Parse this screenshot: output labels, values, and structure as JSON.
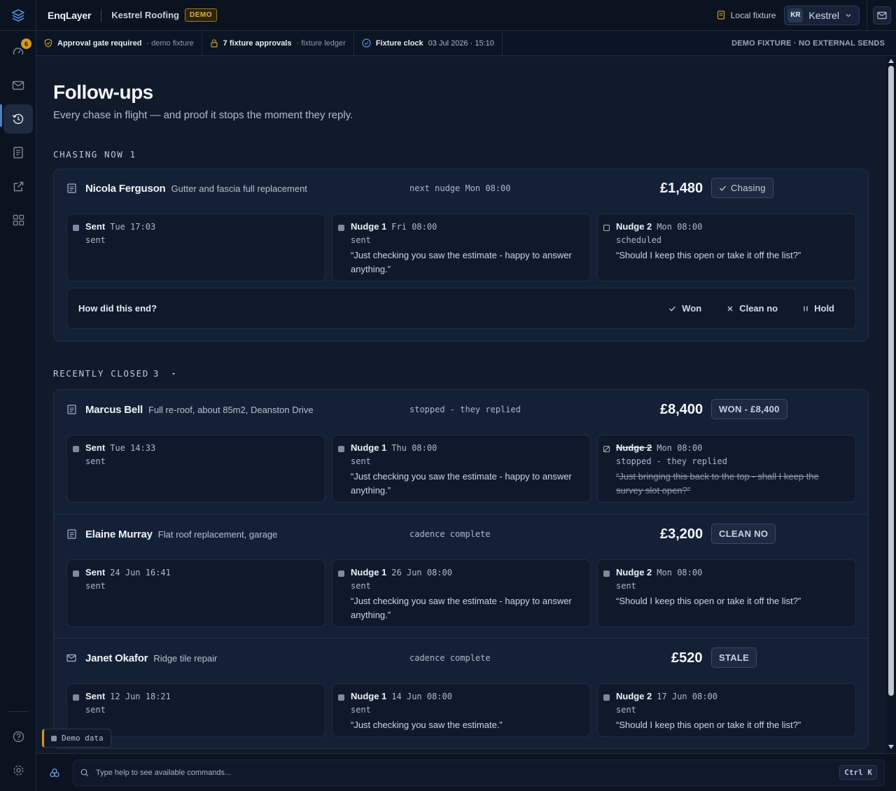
{
  "app": {
    "brand": "EnqLayer",
    "tenant": "Kestrel Roofing",
    "demo_badge": "DEMO",
    "local_fixture": "Local fixture",
    "user_initials": "KR",
    "user_name": "Kestrel"
  },
  "sidebar": {
    "badge_count": "6",
    "items": [
      {
        "icon": "gauge-icon"
      },
      {
        "icon": "mail-icon"
      },
      {
        "icon": "history-icon"
      },
      {
        "icon": "document-icon"
      },
      {
        "icon": "external-link-icon"
      },
      {
        "icon": "grid-icon"
      },
      {
        "icon": "help-icon"
      },
      {
        "icon": "settings-icon"
      }
    ]
  },
  "status": {
    "approval_gate": "Approval gate required",
    "approval_gate_sub": "· demo fixture",
    "approvals": "7 fixture approvals",
    "approvals_sub": "· fixture ledger",
    "clock_label": "Fixture clock",
    "clock_value": "03 Jul 2026 · 15:10",
    "right_notice": "DEMO FIXTURE · NO EXTERNAL SENDS"
  },
  "page": {
    "title": "Follow-ups",
    "subtitle": "Every chase in flight — and proof it stops the moment they reply."
  },
  "chasing": {
    "label": "CHASING NOW",
    "count": "1",
    "item": {
      "name": "Nicola Ferguson",
      "job": "Gutter and fascia full replacement",
      "status": "next nudge Mon 08:00",
      "amount": "£1,480",
      "badge": "Chasing",
      "steps": [
        {
          "title": "Sent",
          "when": "Tue 17:03",
          "state": "sent",
          "message": ""
        },
        {
          "title": "Nudge 1",
          "when": "Fri 08:00",
          "state": "sent",
          "message": "“Just checking you saw the estimate - happy to answer anything.”"
        },
        {
          "title": "Nudge 2",
          "when": "Mon 08:00",
          "state": "scheduled",
          "message": "“Should I keep this open or take it off the list?”"
        }
      ],
      "outcome": {
        "question": "How did this end?",
        "won": "Won",
        "clean_no": "Clean no",
        "hold": "Hold"
      }
    }
  },
  "closed": {
    "label": "RECENTLY CLOSED",
    "count": "3",
    "items": [
      {
        "name": "Marcus Bell",
        "job": "Full re-roof, about 85m2, Deanston Drive",
        "status": "stopped - they replied",
        "amount": "£8,400",
        "badge": "WON - £8,400",
        "steps": [
          {
            "title": "Sent",
            "when": "Tue 14:33",
            "state": "sent",
            "message": ""
          },
          {
            "title": "Nudge 1",
            "when": "Thu 08:00",
            "state": "sent",
            "message": "“Just checking you saw the estimate - happy to answer anything.”"
          },
          {
            "title": "Nudge 2",
            "when": "Mon 08:00",
            "state": "stopped - they replied",
            "message": "“Just bringing this back to the top - shall I keep the survey slot open?”"
          }
        ]
      },
      {
        "name": "Elaine Murray",
        "job": "Flat roof replacement, garage",
        "status": "cadence complete",
        "amount": "£3,200",
        "badge": "CLEAN NO",
        "steps": [
          {
            "title": "Sent",
            "when": "24 Jun 16:41",
            "state": "sent",
            "message": ""
          },
          {
            "title": "Nudge 1",
            "when": "26 Jun 08:00",
            "state": "sent",
            "message": "“Just checking you saw the estimate - happy to answer anything.”"
          },
          {
            "title": "Nudge 2",
            "when": "Mon 08:00",
            "state": "sent",
            "message": "“Should I keep this open or take it off the list?”"
          }
        ]
      },
      {
        "name": "Janet Okafor",
        "job": "Ridge tile repair",
        "status": "cadence complete",
        "amount": "£520",
        "badge": "STALE",
        "steps": [
          {
            "title": "Sent",
            "when": "12 Jun 18:21",
            "state": "sent",
            "message": ""
          },
          {
            "title": "Nudge 1",
            "when": "14 Jun 08:00",
            "state": "sent",
            "message": "“Just checking you saw the estimate.”"
          },
          {
            "title": "Nudge 2",
            "when": "17 Jun 08:00",
            "state": "sent",
            "message": "“Should I keep this open or take it off the list?”"
          }
        ]
      }
    ]
  },
  "demo_pill": "Demo data",
  "command": {
    "placeholder": "Type help to see available commands...",
    "shortcut": "Ctrl K"
  },
  "colors": {
    "background": "#101a2b",
    "card": "#142036",
    "accent": "#4d7fd0",
    "demo_amber": "#e6b43c"
  }
}
